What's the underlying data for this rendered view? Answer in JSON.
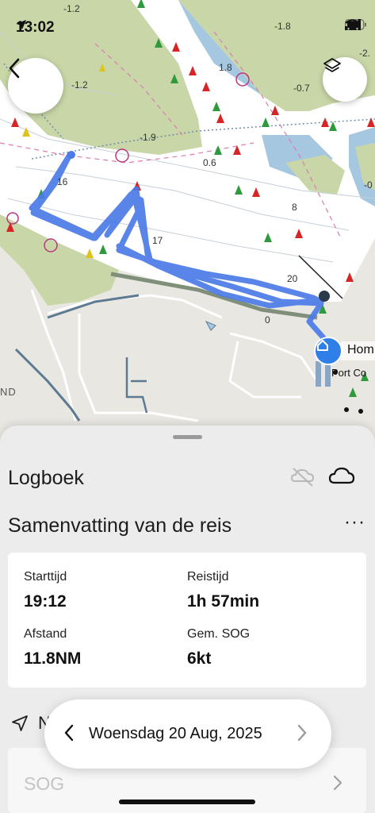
{
  "status_bar": {
    "time": "13:02"
  },
  "map": {
    "depth_labels": [
      "-1.2",
      "-1.2",
      "1.8",
      "-1.9",
      "0.6",
      "-0.7",
      "-1.8",
      "-2.",
      "-0",
      "16",
      "17",
      "8",
      "20",
      "0"
    ],
    "place_labels": {
      "home": "Hom",
      "port": "Port Co",
      "land": "ND"
    },
    "colors": {
      "water": "#ffffff",
      "land": "#c7d5a6",
      "shallow": "#9ec3de",
      "track": "#4c7be8",
      "home_marker": "#2f7fe8",
      "ground": "#e9e7e2"
    }
  },
  "sheet": {
    "logbook_title": "Logboek",
    "summary_title": "Samenvatting van de reis",
    "more_label": "···",
    "stats": {
      "start_label": "Starttijd",
      "start_value": "19:12",
      "duration_label": "Reistijd",
      "duration_value": "1h 57min",
      "distance_label": "Afstand",
      "distance_value": "11.8NM",
      "sog_label": "Gem. SOG",
      "sog_value": "6kt"
    },
    "nav_row_peek": "N",
    "date_label": "Woensdag 20 Aug, 2025",
    "sog_row_label": "SOG"
  },
  "icons": [
    "back-chevron-icon",
    "layers-icon",
    "location-arrow-icon",
    "signal-icon",
    "wifi-icon",
    "battery-icon",
    "no-sync-icon",
    "cloud-icon",
    "navigation-icon",
    "chevron-left-icon",
    "chevron-right-icon",
    "home-icon"
  ]
}
